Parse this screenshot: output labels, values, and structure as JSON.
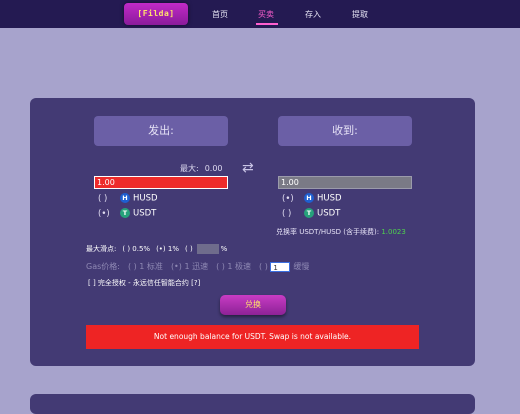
{
  "nav": {
    "logo": "[Filda]",
    "items": [
      {
        "label": "首页"
      },
      {
        "label": "买卖"
      },
      {
        "label": "存入"
      },
      {
        "label": "提取"
      }
    ],
    "active_index": 1
  },
  "swap": {
    "from_label": "发出:",
    "to_label": "收到:",
    "max_label": "最大:",
    "max_value": "0.00",
    "from_amount": "1.00",
    "to_amount": "1.00",
    "from_tokens": [
      {
        "radio": "( )",
        "symbol": "HUSD",
        "icon": "husd-coin-icon"
      },
      {
        "radio": "(•)",
        "symbol": "USDT",
        "icon": "usdt-coin-icon"
      }
    ],
    "to_tokens": [
      {
        "radio": "(•)",
        "symbol": "HUSD",
        "icon": "husd-coin-icon"
      },
      {
        "radio": "( )",
        "symbol": "USDT",
        "icon": "usdt-coin-icon"
      }
    ],
    "rate_label": "兑换率 USDT/HUSD",
    "rate_fee_label": "(含手续费):",
    "rate_value": "1.0023",
    "slippage": {
      "label": "最大滑点:",
      "options": [
        "( ) 0.5%",
        "(•) 1%",
        "( )"
      ],
      "custom_unit": "%"
    },
    "gas": {
      "label": "Gas价格:",
      "options": [
        "( ) 1 标准",
        "(•) 1 迅速",
        "( ) 1 极速",
        "( )"
      ],
      "custom_value": "1",
      "custom_suffix": "缓慢"
    },
    "auth_text": "[ ]  完全授权 - 永远信任智能合约  [?]",
    "swap_button": "兑换",
    "error_message": "Not enough balance for USDT. Swap is not available."
  },
  "colors": {
    "background": "#a7a3cc",
    "nav_bg": "#241a52",
    "panel_bg": "#433a74",
    "accent": "#ff5fd0",
    "error": "#ee2424",
    "rate_value": "#4fd04f"
  }
}
